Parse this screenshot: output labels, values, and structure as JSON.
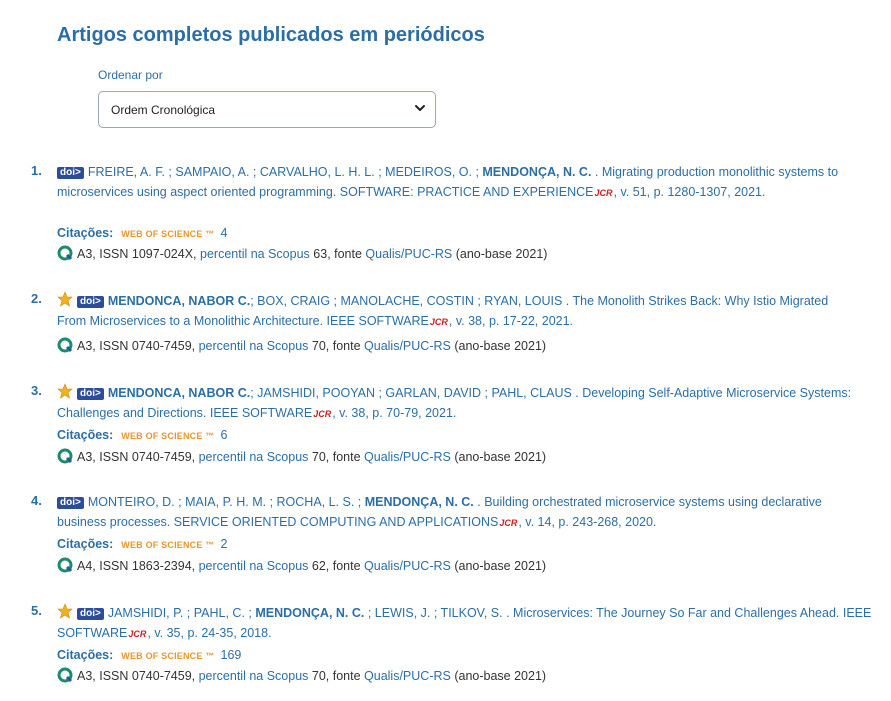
{
  "section": {
    "title": "Artigos completos publicados em periódicos"
  },
  "sort": {
    "label": "Ordenar por",
    "value": "Ordem Cronológica"
  },
  "labels": {
    "doi": "doi>",
    "jcr": "JCR",
    "citations": "Citações:",
    "wos": "WEB OF SCIENCE ™",
    "percentil": "percentil na Scopus",
    "fonte": ", fonte ",
    "qualis": "Qualis/PUC-RS",
    "anobase": " (ano-base 2021)"
  },
  "articles": [
    {
      "num": "1.",
      "starred": false,
      "authors_pre": "FREIRE, A. F. ; SAMPAIO, A. ; CARVALHO, L. H. L. ; MEDEIROS, O. ; ",
      "authors_bold": "MENDONÇA, N. C.",
      "authors_post": "",
      "title_journal": " . Migrating production monolithic systems to microservices using aspect oriented programming. SOFTWARE: PRACTICE AND EXPERIENCE",
      "details": ", v. 51, p. 1280-1307, 2021.",
      "citations": "4",
      "qualis": "A3, ISSN 1097-024X, ",
      "percentil_value": " 63"
    },
    {
      "num": "2.",
      "starred": true,
      "authors_pre": "",
      "authors_bold": "MENDONCA, NABOR C.",
      "authors_post": "; BOX, CRAIG ; MANOLACHE, COSTIN ; RYAN, LOUIS",
      "title_journal": " . The Monolith Strikes Back: Why Istio Migrated From Microservices to a Monolithic Architecture. IEEE SOFTWARE",
      "details": ", v. 38, p. 17-22, 2021.",
      "citations": "",
      "qualis": "A3, ISSN 0740-7459, ",
      "percentil_value": " 70"
    },
    {
      "num": "3.",
      "starred": true,
      "authors_pre": "",
      "authors_bold": "MENDONCA, NABOR C.",
      "authors_post": "; JAMSHIDI, POOYAN ; GARLAN, DAVID ; PAHL, CLAUS",
      "title_journal": " . Developing Self-Adaptive Microservice Systems: Challenges and Directions. IEEE SOFTWARE",
      "details": ", v. 38, p. 70-79, 2021.",
      "citations": "6",
      "qualis": "A3, ISSN 0740-7459, ",
      "percentil_value": " 70"
    },
    {
      "num": "4.",
      "starred": false,
      "authors_pre": "MONTEIRO, D. ; MAIA, P. H. M. ; ROCHA, L. S. ; ",
      "authors_bold": "MENDONÇA, N. C.",
      "authors_post": "",
      "title_journal": " . Building orchestrated microservice systems using declarative business processes. SERVICE ORIENTED COMPUTING AND APPLICATIONS",
      "details": ", v. 14, p. 243-268, 2020.",
      "citations": "2",
      "qualis": "A4, ISSN 1863-2394, ",
      "percentil_value": " 62"
    },
    {
      "num": "5.",
      "starred": true,
      "authors_pre": "JAMSHIDI, P. ; PAHL, C. ; ",
      "authors_bold": "MENDONÇA, N. C.",
      "authors_post": " ; LEWIS, J. ; TILKOV, S.",
      "title_journal": " . Microservices: The Journey So Far and Challenges Ahead. IEEE SOFTWARE",
      "details": ", v. 35, p. 24-35, 2018.",
      "citations": "169",
      "qualis": "A3, ISSN 0740-7459, ",
      "percentil_value": " 70"
    }
  ],
  "colors": {
    "link": "#2b6ea6",
    "doi_bg": "#2b4d9a",
    "jcr": "#cc1f1f",
    "wos": "#e8962b",
    "star": "#f2b01e"
  }
}
